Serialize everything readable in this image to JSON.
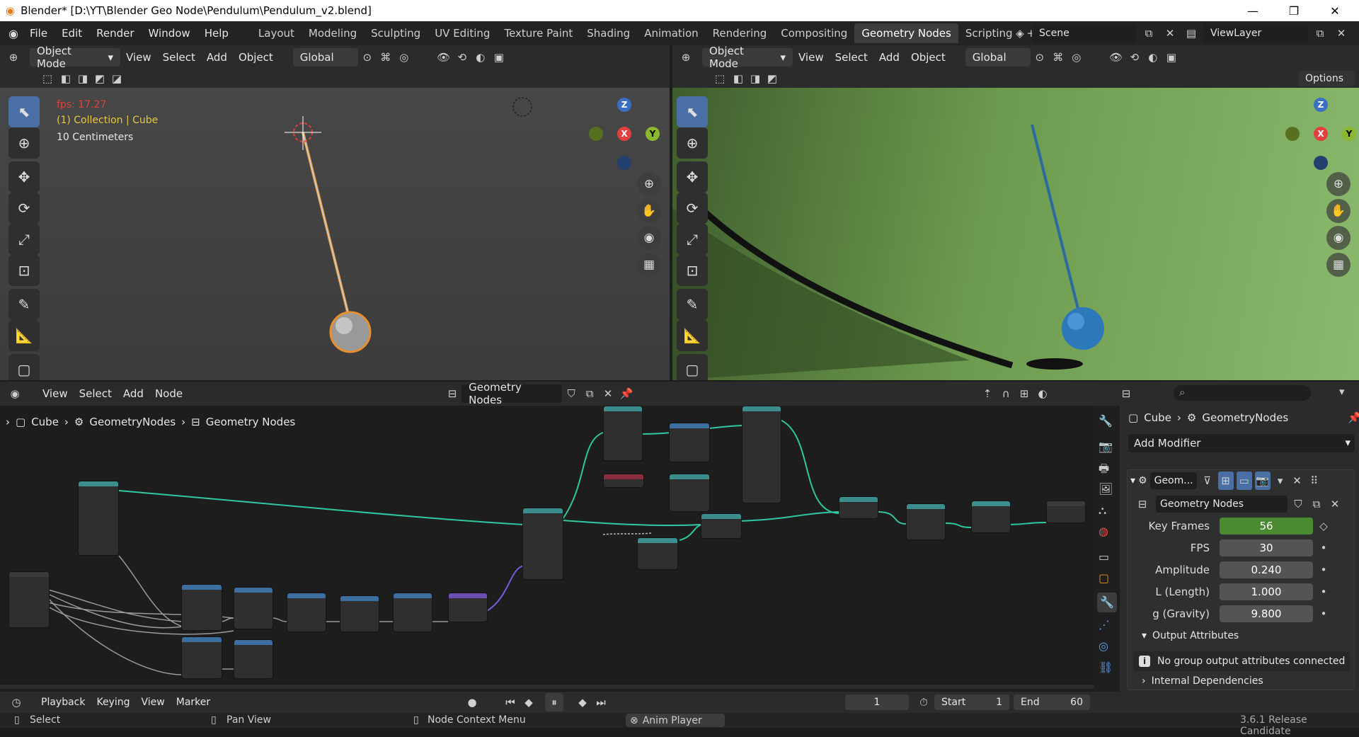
{
  "window": {
    "title": "Blender* [D:\\YT\\Blender Geo Node\\Pendulum\\Pendulum_v2.blend]"
  },
  "menu": {
    "items": [
      "File",
      "Edit",
      "Render",
      "Window",
      "Help"
    ]
  },
  "workspaces": [
    "Layout",
    "Modeling",
    "Sculpting",
    "UV Editing",
    "Texture Paint",
    "Shading",
    "Animation",
    "Rendering",
    "Compositing",
    "Geometry Nodes",
    "Scripting"
  ],
  "scene": {
    "name": "Scene",
    "view_layer": "ViewLayer"
  },
  "viewport_header": {
    "mode": "Object Mode",
    "menus": [
      "View",
      "Select",
      "Add",
      "Object"
    ],
    "orientation": "Global",
    "options": "Options"
  },
  "viewport_left": {
    "fps": "fps: 17.27",
    "collection": "(1) Collection | Cube",
    "scale": "10 Centimeters"
  },
  "gizmo": {
    "x": "X",
    "y": "Y",
    "z": "Z"
  },
  "node_editor": {
    "menus": [
      "View",
      "Select",
      "Add",
      "Node"
    ],
    "tree_name": "Geometry Nodes",
    "breadcrumb": [
      "Cube",
      "GeometryNodes",
      "Geometry Nodes"
    ]
  },
  "properties": {
    "object": "Cube",
    "modifier_tab": "GeometryNodes",
    "add_modifier": "Add Modifier",
    "modifier_name": "Geom...",
    "node_group": "Geometry Nodes",
    "inputs": [
      {
        "label": "Key Frames",
        "value": "56"
      },
      {
        "label": "FPS",
        "value": "30"
      },
      {
        "label": "Amplitude",
        "value": "0.240"
      },
      {
        "label": "L (Length)",
        "value": "1.000"
      },
      {
        "label": "g (Gravity)",
        "value": "9.800"
      }
    ],
    "output_attributes": "Output Attributes",
    "no_output_msg": "No group output attributes connected",
    "internal_deps": "Internal Dependencies"
  },
  "timeline": {
    "menus": [
      "Playback",
      "Keying",
      "View",
      "Marker"
    ],
    "current_frame": "1",
    "start_label": "Start",
    "start": "1",
    "end_label": "End",
    "end": "60"
  },
  "status": {
    "select": "Select",
    "pan": "Pan View",
    "context": "Node Context Menu",
    "anim_player": "Anim Player",
    "version": "3.6.1 Release Candidate"
  },
  "colors": {
    "accent": "#4a6fa5",
    "socket_green": "#2fc7a0",
    "keyframe_green": "#4a8a30"
  }
}
